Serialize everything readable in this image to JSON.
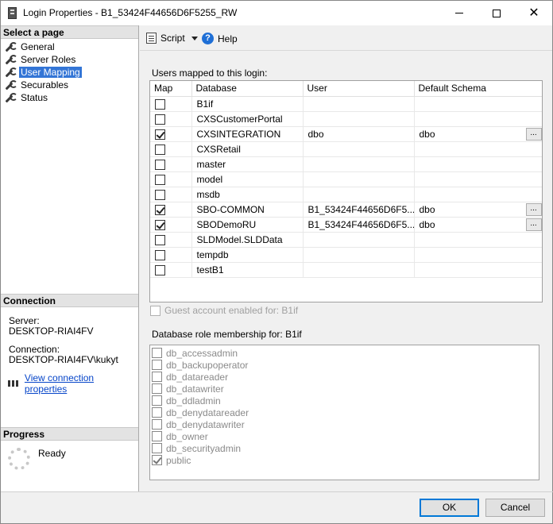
{
  "window": {
    "title": "Login Properties - B1_53424F44656D6F5255_RW",
    "minimize_glyph": "",
    "maximize_glyph": "",
    "close_glyph": "✕"
  },
  "left": {
    "select_page_header": "Select a page",
    "pages": [
      {
        "label": "General",
        "icon": "wrench-icon",
        "selected": false
      },
      {
        "label": "Server Roles",
        "icon": "wrench-icon",
        "selected": false
      },
      {
        "label": "User Mapping",
        "icon": "wrench-icon",
        "selected": true
      },
      {
        "label": "Securables",
        "icon": "wrench-icon",
        "selected": false
      },
      {
        "label": "Status",
        "icon": "wrench-icon",
        "selected": false
      }
    ],
    "connection_header": "Connection",
    "server_label": "Server:",
    "server_value": "DESKTOP-RIAI4FV",
    "connection_label": "Connection:",
    "connection_value": "DESKTOP-RIAI4FV\\kukyt",
    "view_link": "View connection properties",
    "progress_header": "Progress",
    "progress_status": "Ready"
  },
  "toolbar": {
    "script_label": "Script",
    "help_label": "Help",
    "help_glyph": "?"
  },
  "mapping": {
    "section_label": "Users mapped to this login:",
    "columns": [
      "Map",
      "Database",
      "User",
      "Default Schema"
    ],
    "ellipsis": "...",
    "rows": [
      {
        "checked": false,
        "database": "B1if",
        "user": "",
        "schema": "",
        "has_button": false
      },
      {
        "checked": false,
        "database": "CXSCustomerPortal",
        "user": "",
        "schema": "",
        "has_button": false
      },
      {
        "checked": true,
        "database": "CXSINTEGRATION",
        "user": "dbo",
        "schema": "dbo",
        "has_button": true
      },
      {
        "checked": false,
        "database": "CXSRetail",
        "user": "",
        "schema": "",
        "has_button": false
      },
      {
        "checked": false,
        "database": "master",
        "user": "",
        "schema": "",
        "has_button": false
      },
      {
        "checked": false,
        "database": "model",
        "user": "",
        "schema": "",
        "has_button": false
      },
      {
        "checked": false,
        "database": "msdb",
        "user": "",
        "schema": "",
        "has_button": false
      },
      {
        "checked": true,
        "database": "SBO-COMMON",
        "user": "B1_53424F44656D6F5...",
        "schema": "dbo",
        "has_button": true
      },
      {
        "checked": true,
        "database": "SBODemoRU",
        "user": "B1_53424F44656D6F5...",
        "schema": "dbo",
        "has_button": true
      },
      {
        "checked": false,
        "database": "SLDModel.SLDData",
        "user": "",
        "schema": "",
        "has_button": false
      },
      {
        "checked": false,
        "database": "tempdb",
        "user": "",
        "schema": "",
        "has_button": false
      },
      {
        "checked": false,
        "database": "testB1",
        "user": "",
        "schema": "",
        "has_button": false
      }
    ]
  },
  "guest": {
    "label": "Guest account enabled for: B1if",
    "checked": false
  },
  "roles": {
    "section_label": "Database role membership for: B1if",
    "items": [
      {
        "label": "db_accessadmin",
        "checked": false
      },
      {
        "label": "db_backupoperator",
        "checked": false
      },
      {
        "label": "db_datareader",
        "checked": false
      },
      {
        "label": "db_datawriter",
        "checked": false
      },
      {
        "label": "db_ddladmin",
        "checked": false
      },
      {
        "label": "db_denydatareader",
        "checked": false
      },
      {
        "label": "db_denydatawriter",
        "checked": false
      },
      {
        "label": "db_owner",
        "checked": false
      },
      {
        "label": "db_securityadmin",
        "checked": false
      },
      {
        "label": "public",
        "checked": true
      }
    ]
  },
  "buttons": {
    "ok": "OK",
    "cancel": "Cancel"
  },
  "colors": {
    "selection": "#3375d6",
    "link": "#0645c9",
    "ok_border": "#0078d7"
  }
}
